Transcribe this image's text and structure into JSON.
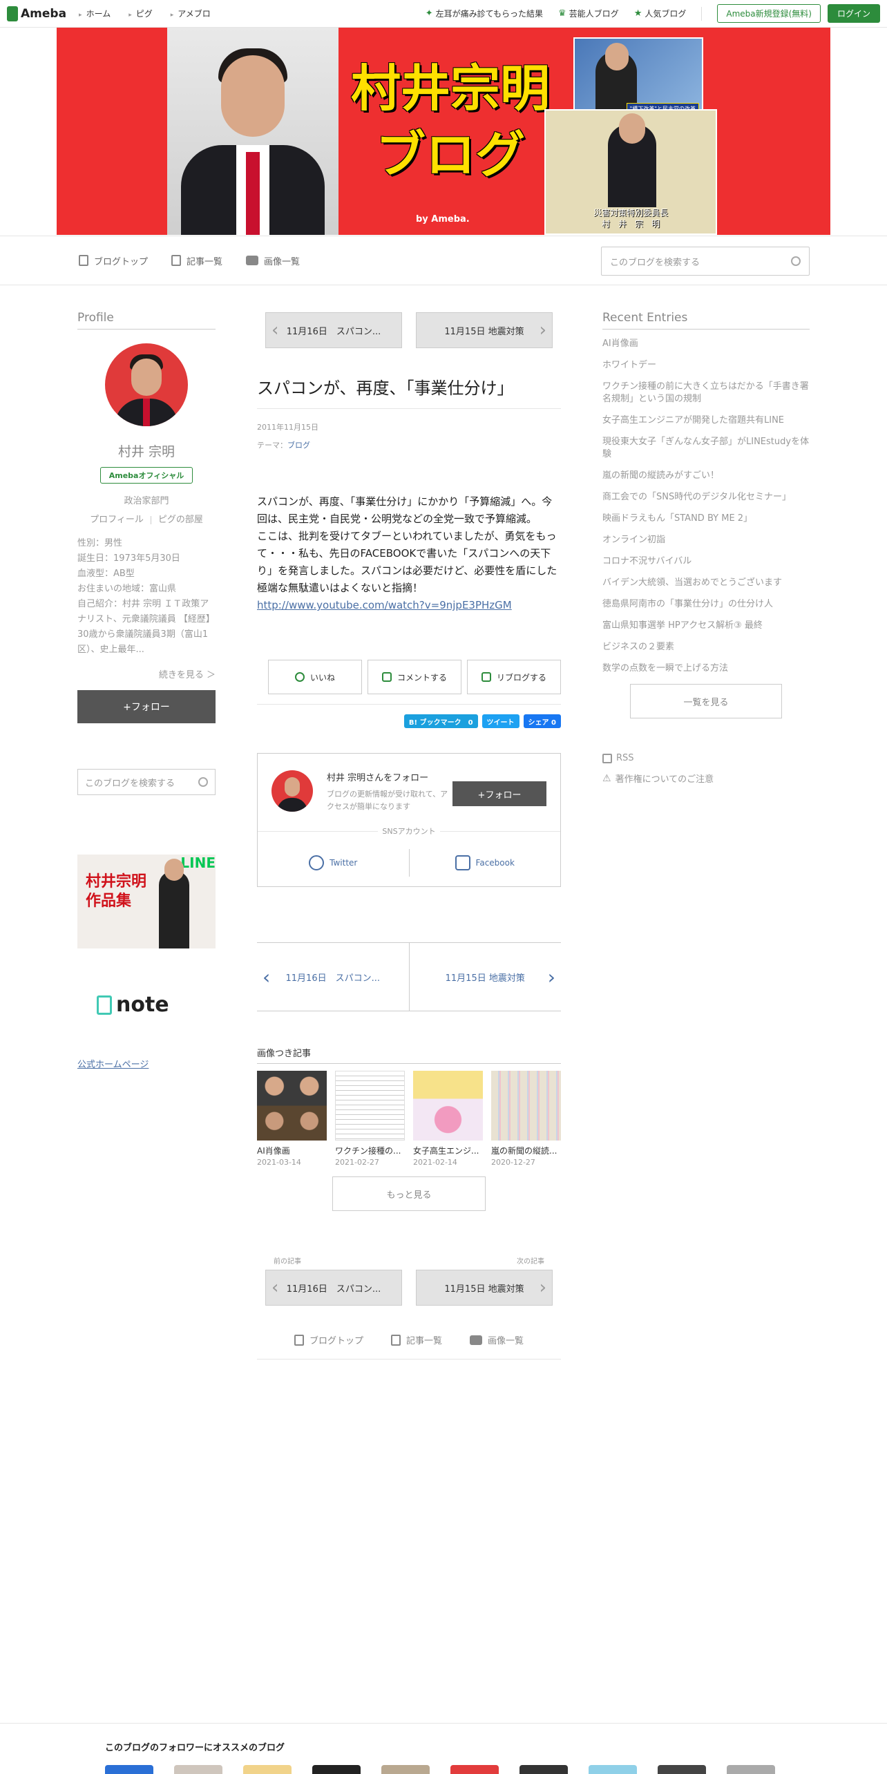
{
  "topbar": {
    "logo": "Ameba",
    "nav": [
      "ホーム",
      "ピグ",
      "アメブロ"
    ],
    "links": [
      "左耳が痛み診てもらった結果",
      "芸能人ブログ",
      "人気ブログ"
    ],
    "register": "Ameba新規登録(無料)",
    "login": "ログイン"
  },
  "header": {
    "title_line1": "村井宗明",
    "title_line2": "ブログ",
    "by": "by Ameba.",
    "tv_caption": "\"橋下改革\"と民主党の改革",
    "stage_caption1": "災害対策特別委員長",
    "stage_caption2": "村　井　宗　明"
  },
  "blognav": {
    "items": [
      "ブログトップ",
      "記事一覧",
      "画像一覧"
    ],
    "search_placeholder": "このブログを検索する"
  },
  "profile": {
    "heading": "Profile",
    "name": "村井 宗明",
    "official": "Amebaオフィシャル",
    "category": "政治家部門",
    "link_profile": "プロフィール",
    "link_room": "ピグの部屋",
    "info": [
      "性別：男性",
      "誕生日：1973年5月30日",
      "血液型：AB型",
      "お住まいの地域：富山県",
      "自己紹介：村井 宗明 ＩＴ政策アナリスト、元衆議院議員 【経歴】30歳から衆議院議員3期（富山1区）、史上最年..."
    ],
    "more": "続きを見る ＞",
    "follow": "+フォロー",
    "search_placeholder": "このブログを検索する",
    "banner_text1": "村井宗明",
    "banner_text2": "作品集",
    "banner_line": "LINE",
    "note": "note",
    "homepage": "公式ホームページ"
  },
  "article": {
    "prev": "11月16日　スパコン...",
    "next": "11月15日 地震対策",
    "title": "スパコンが、再度、「事業仕分け」",
    "date": "2011年11月15日",
    "theme_label": "テーマ：",
    "theme": "ブログ",
    "body1": "スパコンが、再度、「事業仕分け」にかかり「予算縮減」へ。今回は、民主党・自民党・公明党などの全党一致で予算縮減。",
    "body2": "ここは、批判を受けてタブーといわれていましたが、勇気をもって・・・私も、先日のFACEBOOKで書いた「スパコンへの天下り」を発言しました。スパコンは必要だけど、必要性を盾にした極端な無駄遣いはよくないと指摘！",
    "link": "http://www.youtube.com/watch?v=9njpE3PHzGM",
    "like": "いいね",
    "comment": "コメントする",
    "reblog": "リブログする",
    "hatebu": "B! ブックマーク　0",
    "tweet": "ツイート",
    "share": "シェア 0",
    "follow_name": "村井 宗明さんをフォロー",
    "follow_desc": "ブログの更新情報が受け取れて、アクセスが簡単になります",
    "follow_btn": "+フォロー",
    "sns_label": "SNSアカウント",
    "twitter": "Twitter",
    "facebook": "Facebook",
    "images_heading": "画像つき記事",
    "thumbs": [
      {
        "title": "AI肖像画",
        "date": "2021-03-14"
      },
      {
        "title": "ワクチン接種の...",
        "date": "2021-02-27"
      },
      {
        "title": "女子高生エンジ...",
        "date": "2021-02-14"
      },
      {
        "title": "嵐の新聞の縦読...",
        "date": "2020-12-27"
      }
    ],
    "more": "もっと見る",
    "prev_label": "前の記事",
    "next_label": "次の記事"
  },
  "recent": {
    "heading": "Recent Entries",
    "entries": [
      "AI肖像画",
      "ホワイトデー",
      "ワクチン接種の前に大きく立ちはだかる「手書き署名規制」という国の規制",
      "女子高生エンジニアが開発した宿題共有LINE",
      "現役東大女子「ぎんなん女子部」がLINEstudyを体験",
      "嵐の新聞の縦読みがすごい！",
      "商工会での「SNS時代のデジタル化セミナー」",
      "映画ドラえもん「STAND BY ME 2」",
      "オンライン初詣",
      "コロナ不況サバイバル",
      "バイデン大統領、当選おめでとうございます",
      "徳島県阿南市の「事業仕分け」の仕分け人",
      "富山県知事選挙 HPアクセス解析③ 最終",
      "ビジネスの２要素",
      "数学の点数を一瞬で上げる方法"
    ],
    "all": "一覧を見る",
    "rss": "RSS",
    "copyright": "著作権についてのご注意"
  },
  "bottom": {
    "heading": "このブログのフォロワーにオススメのブログ"
  },
  "colors": {
    "accent": "#2d8c3c",
    "header_bg": "#ee2f30",
    "title_yellow": "#ffe000",
    "link": "#4a6fa5"
  }
}
